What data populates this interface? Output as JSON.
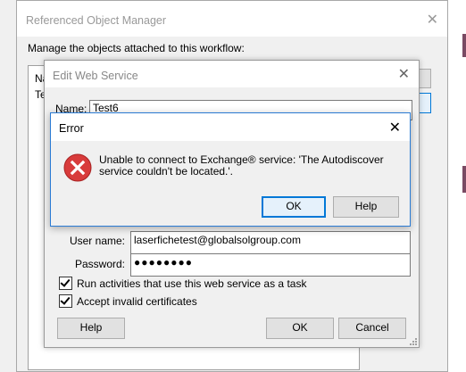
{
  "colors": {
    "accent": "#0078d7",
    "error_red": "#d83b3b",
    "error_border": "#2a7bd4",
    "desktop_strip": "#7a4a63"
  },
  "ref_manager": {
    "title": "Referenced Object Manager",
    "description": "Manage the objects attached to this workflow:",
    "list_items": [
      "Na",
      "Te"
    ]
  },
  "edit_service": {
    "title": "Edit Web Service",
    "name_label": "Name:",
    "name_value": "Test6",
    "username_label": "User name:",
    "username_value": "laserfichetest@globalsolgroup.com",
    "password_label": "Password:",
    "password_value": "●●●●●●●●",
    "checkbox_run_tasks": "Run activities that use this web service as a task",
    "checkbox_invalid_certs": "Accept invalid certificates",
    "help_label": "Help",
    "ok_label": "OK",
    "cancel_label": "Cancel"
  },
  "error_dialog": {
    "title": "Error",
    "icon": "error-icon",
    "message": "Unable to connect to Exchange® service: 'The Autodiscover service couldn't be located.'.",
    "ok_label": "OK",
    "help_label": "Help"
  }
}
